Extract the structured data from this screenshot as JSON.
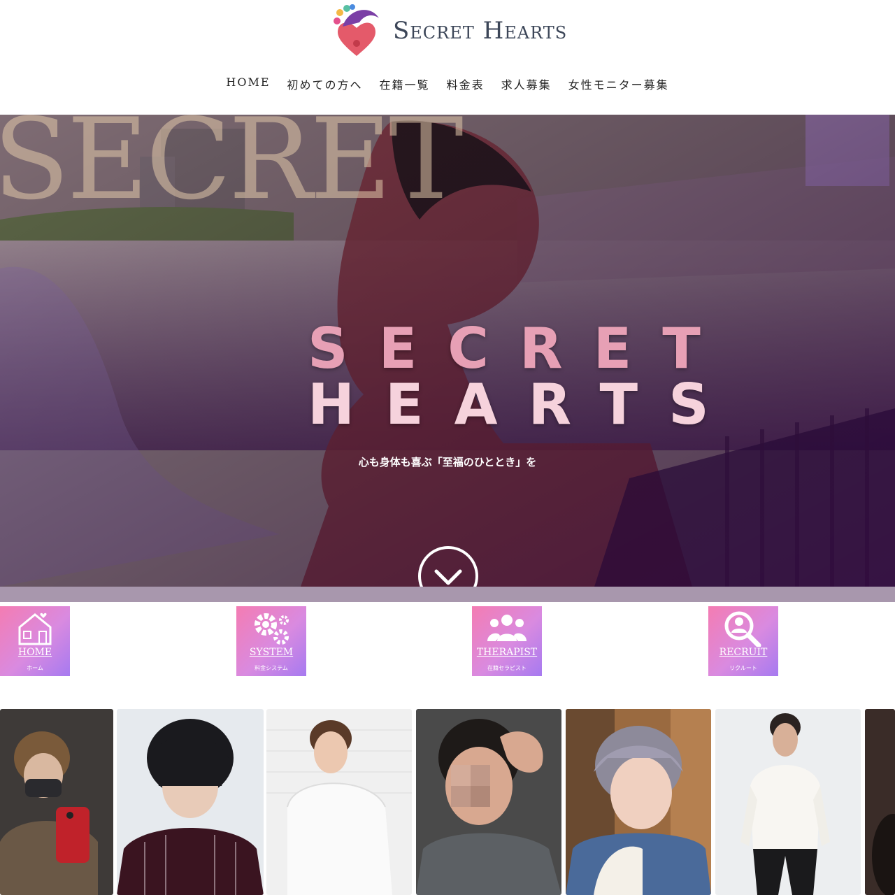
{
  "brand": {
    "name": "Secret Hearts"
  },
  "nav": {
    "items": [
      {
        "label": "HOME"
      },
      {
        "label": "初めての方へ"
      },
      {
        "label": "在籍一覧"
      },
      {
        "label": "料金表"
      },
      {
        "label": "求人募集"
      },
      {
        "label": "女性モニター募集"
      }
    ]
  },
  "hero": {
    "bg_word": "SECRET",
    "title_line1": "SECRET",
    "title_line2": "HEARTS",
    "tagline": "心も身体も喜ぶ「至福のひととき」を"
  },
  "tiles": [
    {
      "label": "HOME",
      "sub": "ホーム",
      "icon": "house-icon"
    },
    {
      "label": "SYSTEM",
      "sub": "料金システム",
      "icon": "gears-icon"
    },
    {
      "label": "THERAPIST",
      "sub": "在籍セラピスト",
      "icon": "group-icon"
    },
    {
      "label": "RECRUIT",
      "sub": "リクルート",
      "icon": "search-person-icon"
    }
  ],
  "gallery": {
    "count_visible": 7
  }
}
